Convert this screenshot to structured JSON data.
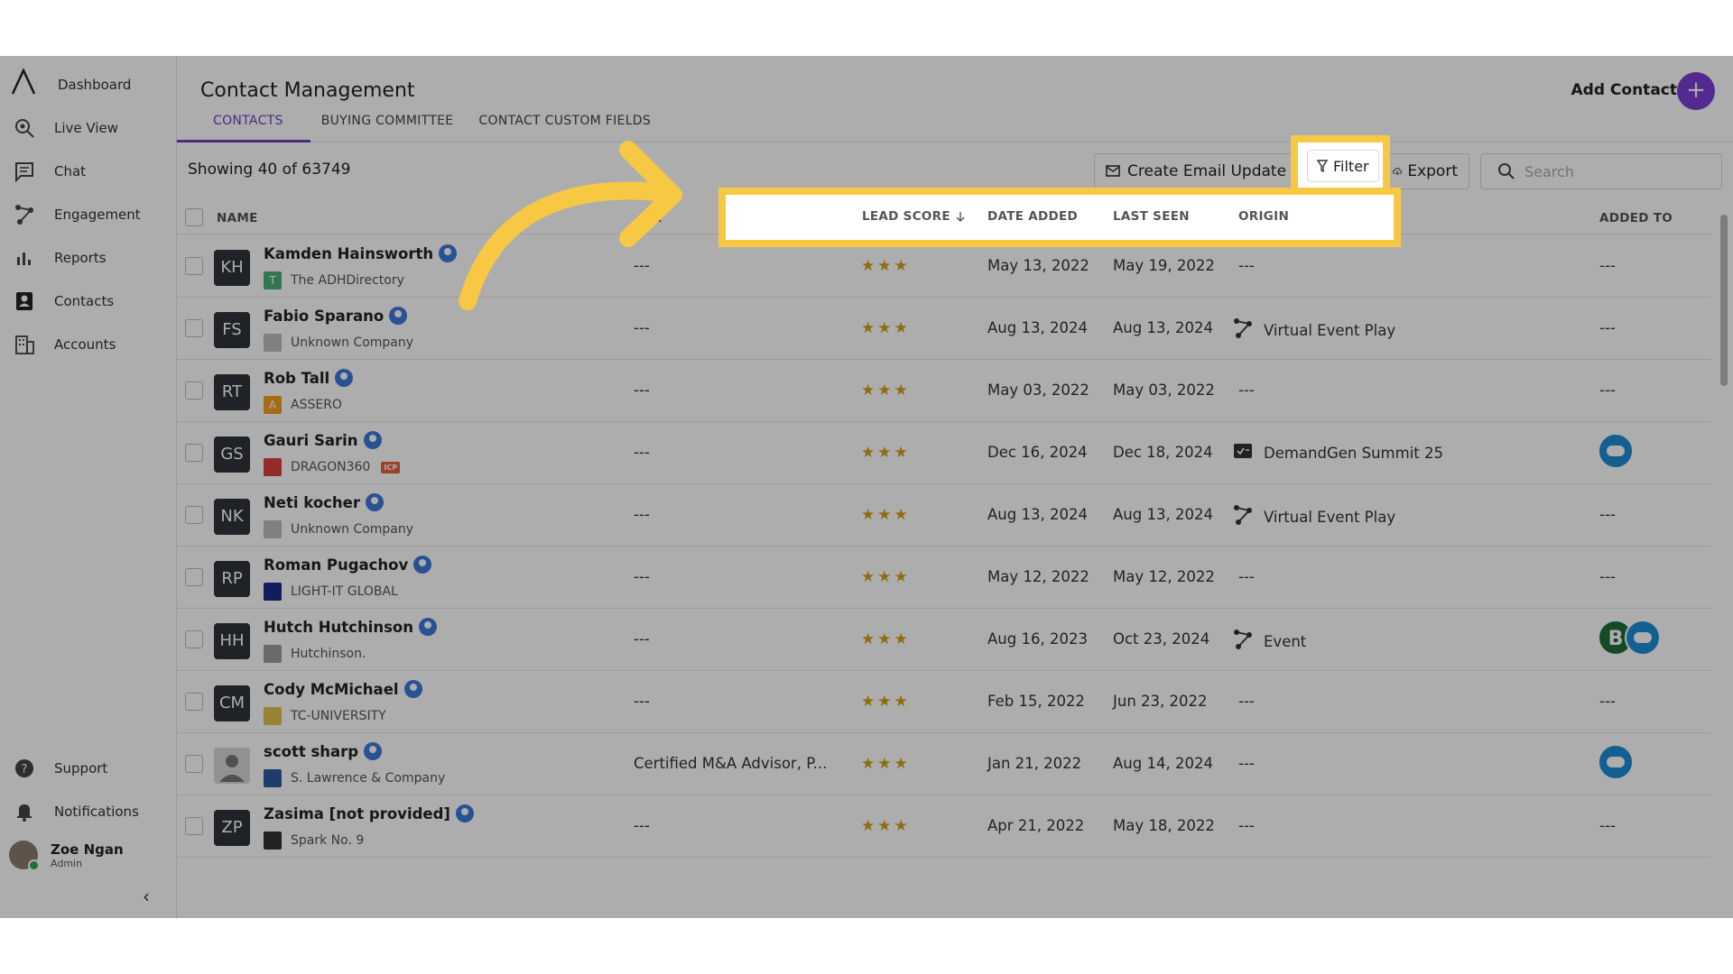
{
  "sidebar": {
    "items": [
      {
        "label": "Dashboard"
      },
      {
        "label": "Live View"
      },
      {
        "label": "Chat"
      },
      {
        "label": "Engagement"
      },
      {
        "label": "Reports"
      },
      {
        "label": "Contacts"
      },
      {
        "label": "Accounts"
      }
    ],
    "bottom": [
      {
        "label": "Support"
      },
      {
        "label": "Notifications"
      }
    ],
    "user": {
      "name": "Zoe Ngan",
      "role": "Admin"
    }
  },
  "header": {
    "title": "Contact Management",
    "tabs": [
      {
        "label": "CONTACTS",
        "active": true
      },
      {
        "label": "BUYING COMMITTEE"
      },
      {
        "label": "CONTACT CUSTOM FIELDS"
      }
    ],
    "add_contact": "Add Contact",
    "add_symbol": "+"
  },
  "toolbar": {
    "showing": "Showing 40 of  63749",
    "create_email_update": "Create Email Update",
    "filter": "Filter",
    "export": "Export",
    "search_placeholder": "Search"
  },
  "table": {
    "headers": {
      "name": "NAME",
      "title_partial": "E",
      "lead_score": "LEAD SCORE",
      "date_added": "DATE ADDED",
      "last_seen": "LAST SEEN",
      "origin": "ORIGIN",
      "added_to": "ADDED TO"
    },
    "rows": [
      {
        "initials": "KH",
        "name": "Kamden Hainsworth",
        "company": "The ADHDirectory",
        "logo_color": "#4caf7a",
        "logo_text": "T",
        "title": "---",
        "stars": "★★★",
        "date_added": "May 13, 2022",
        "last_seen": "May 19, 2022",
        "origin": "---",
        "added_to": "---"
      },
      {
        "initials": "FS",
        "name": "Fabio Sparano",
        "company": "Unknown Company",
        "logo_color": "#bdbdbd",
        "logo_text": "",
        "title": "---",
        "stars": "★★★",
        "date_added": "Aug 13, 2024",
        "last_seen": "Aug 13, 2024",
        "origin": "Virtual Event Play",
        "origin_icon": "engagement-icon",
        "added_to": "---"
      },
      {
        "initials": "RT",
        "name": "Rob Tall",
        "company": "ASSERO",
        "logo_color": "#f0a020",
        "logo_text": "A",
        "title": "---",
        "stars": "★★★",
        "date_added": "May 03, 2022",
        "last_seen": "May 03, 2022",
        "origin": "---",
        "added_to": "---"
      },
      {
        "initials": "GS",
        "name": "Gauri Sarin",
        "company": "DRAGON360",
        "logo_color": "#d94040",
        "logo_text": "",
        "icp": "ICP",
        "title": "---",
        "stars": "★★★",
        "date_added": "Dec 16, 2024",
        "last_seen": "Dec 18, 2024",
        "origin": "DemandGen Summit 25",
        "origin_icon": "form-icon",
        "added_to": "salesforce"
      },
      {
        "initials": "NK",
        "name": "Neti kocher",
        "company": "Unknown Company",
        "logo_color": "#bdbdbd",
        "logo_text": "",
        "title": "---",
        "stars": "★★★",
        "date_added": "Aug 13, 2024",
        "last_seen": "Aug 13, 2024",
        "origin": "Virtual Event Play",
        "origin_icon": "engagement-icon",
        "added_to": "---"
      },
      {
        "initials": "RP",
        "name": "Roman Pugachov",
        "company": "LIGHT-IT GLOBAL",
        "logo_color": "#1c2a8a",
        "logo_text": "",
        "title": "---",
        "stars": "★★★",
        "date_added": "May 12, 2022",
        "last_seen": "May 12, 2022",
        "origin": "---",
        "added_to": "---"
      },
      {
        "initials": "HH",
        "name": "Hutch Hutchinson",
        "company": "Hutchinson.",
        "logo_color": "#9e9e9e",
        "logo_text": "",
        "title": "---",
        "stars": "★★★",
        "date_added": "Aug 16, 2023",
        "last_seen": "Oct 23, 2024",
        "origin": "Event",
        "origin_icon": "engagement-icon",
        "added_to": "bombora+salesforce"
      },
      {
        "initials": "CM",
        "name": "Cody McMichael",
        "company": "TC-UNIVERSITY",
        "logo_color": "#e0c050",
        "logo_text": "",
        "title": "---",
        "stars": "★★★",
        "date_added": "Feb 15, 2022",
        "last_seen": "Jun 23, 2022",
        "origin": "---",
        "added_to": "---"
      },
      {
        "initials": "",
        "name": "scott sharp",
        "company": "S. Lawrence & Company",
        "logo_color": "#2c5aa0",
        "logo_text": "",
        "title": "Certified M&A Advisor, P...",
        "stars": "★★★",
        "date_added": "Jan 21, 2022",
        "last_seen": "Aug 14, 2024",
        "origin": "---",
        "added_to": "salesforce"
      },
      {
        "initials": "ZP",
        "name": "Zasima [not provided]",
        "company": "Spark No. 9",
        "logo_color": "#333333",
        "logo_text": "",
        "title": "---",
        "stars": "★★★",
        "date_added": "Apr 21, 2022",
        "last_seen": "May 18, 2022",
        "origin": "---",
        "added_to": "---"
      }
    ]
  },
  "colors": {
    "accent": "#6d3fc0",
    "highlight": "#f7c843",
    "star": "#d4a017"
  }
}
